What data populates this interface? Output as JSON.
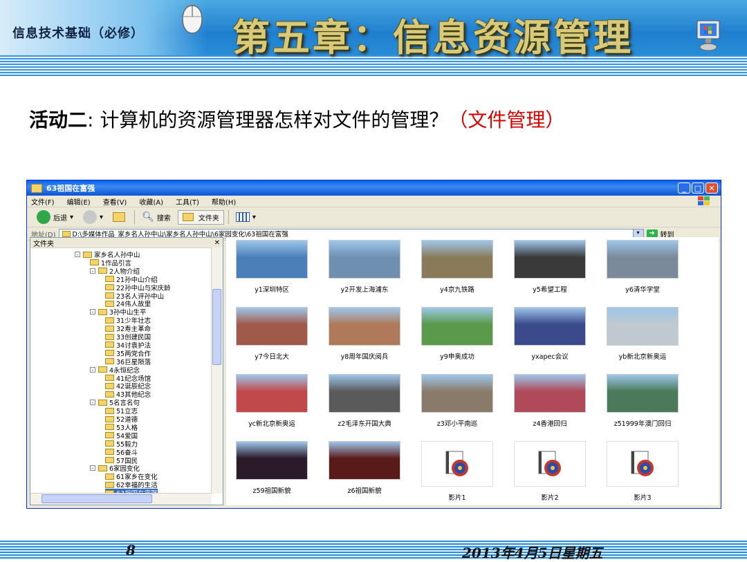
{
  "header": {
    "course": "信息技术基础（必修）",
    "chapter_title": "第五章：信息资源管理"
  },
  "question": {
    "label": "活动二",
    "sep": ":",
    "text": " 计算机的资源管理器怎样对文件的管理？",
    "highlight": "（文件管理）",
    "highlight_color": "#d40000"
  },
  "window": {
    "title": "63祖国在富强",
    "menu": [
      "文件(F)",
      "编辑(E)",
      "查看(V)",
      "收藏(A)",
      "工具(T)",
      "帮助(H)"
    ],
    "toolbar": {
      "back": "后退",
      "search": "搜索",
      "folders": "文件夹"
    },
    "address_label": "地址(D)",
    "address_value": "D:\\多媒体作品_家乡名人孙中山\\家乡名人孙中山\\6家园变化\\63祖国在富强",
    "go": "转到",
    "left_pane_title": "文件夹",
    "tree": [
      {
        "label": "家乡名人孙中山",
        "level": 0,
        "toggle": "⊟"
      },
      {
        "label": "1作品引言",
        "level": 1,
        "toggle": ""
      },
      {
        "label": "2人物介绍",
        "level": 1,
        "toggle": "⊟"
      },
      {
        "label": "21孙中山介绍",
        "level": 2,
        "toggle": ""
      },
      {
        "label": "22孙中山与宋庆龄",
        "level": 2,
        "toggle": ""
      },
      {
        "label": "23名人评孙中山",
        "level": 2,
        "toggle": ""
      },
      {
        "label": "24伟人故里",
        "level": 2,
        "toggle": ""
      },
      {
        "label": "3孙中山生平",
        "level": 1,
        "toggle": "⊟"
      },
      {
        "label": "31少年壮志",
        "level": 2,
        "toggle": ""
      },
      {
        "label": "32寿主革命",
        "level": 2,
        "toggle": ""
      },
      {
        "label": "33创建民国",
        "level": 2,
        "toggle": ""
      },
      {
        "label": "34讨袁护法",
        "level": 2,
        "toggle": ""
      },
      {
        "label": "35两党合作",
        "level": 2,
        "toggle": ""
      },
      {
        "label": "36巨星陨落",
        "level": 2,
        "toggle": ""
      },
      {
        "label": "4永恒纪念",
        "level": 1,
        "toggle": "⊟"
      },
      {
        "label": "41纪念场馆",
        "level": 2,
        "toggle": ""
      },
      {
        "label": "42诞辰纪念",
        "level": 2,
        "toggle": ""
      },
      {
        "label": "43其他纪念",
        "level": 2,
        "toggle": ""
      },
      {
        "label": "5名言名句",
        "level": 1,
        "toggle": "⊟"
      },
      {
        "label": "51立志",
        "level": 2,
        "toggle": ""
      },
      {
        "label": "52道德",
        "level": 2,
        "toggle": ""
      },
      {
        "label": "53人格",
        "level": 2,
        "toggle": ""
      },
      {
        "label": "54爱国",
        "level": 2,
        "toggle": ""
      },
      {
        "label": "55毅力",
        "level": 2,
        "toggle": ""
      },
      {
        "label": "56奋斗",
        "level": 2,
        "toggle": ""
      },
      {
        "label": "57国民",
        "level": 2,
        "toggle": ""
      },
      {
        "label": "6家园变化",
        "level": 1,
        "toggle": "⊟"
      },
      {
        "label": "61家乡在变化",
        "level": 2,
        "toggle": ""
      },
      {
        "label": "62幸福的生活",
        "level": 2,
        "toggle": ""
      },
      {
        "label": "63祖国在富强",
        "level": 2,
        "toggle": "",
        "selected": true
      }
    ],
    "files": [
      {
        "name": "y1深圳特区",
        "kind": "image",
        "color": "#4a7fb8"
      },
      {
        "name": "y2开发上海浦东",
        "kind": "image",
        "color": "#6f8fb0"
      },
      {
        "name": "y4京九铁路",
        "kind": "image",
        "color": "#8a7a5a"
      },
      {
        "name": "y5希望工程",
        "kind": "image",
        "color": "#3a3a3a"
      },
      {
        "name": "y6清华学堂",
        "kind": "image",
        "color": "#7a8a9a"
      },
      {
        "name": "y7今日北大",
        "kind": "image",
        "color": "#a05a4a"
      },
      {
        "name": "y8周年国庆阅兵",
        "kind": "image",
        "color": "#b07a5a"
      },
      {
        "name": "y9申奥成功",
        "kind": "image",
        "color": "#5a9a4a"
      },
      {
        "name": "yxapec会议",
        "kind": "image",
        "color": "#3a4a8a"
      },
      {
        "name": "yb新北京新奥运",
        "kind": "image",
        "color": "#c0c8d0"
      },
      {
        "name": "yc新北京新奥运",
        "kind": "image",
        "color": "#c04a4a"
      },
      {
        "name": "z2毛泽东开国大典",
        "kind": "image",
        "color": "#5a5a5a"
      },
      {
        "name": "z3邓小平南巡",
        "kind": "image",
        "color": "#8a7a6a"
      },
      {
        "name": "z4香港回归",
        "kind": "image",
        "color": "#b04a5a"
      },
      {
        "name": "z51999年澳门回归",
        "kind": "image",
        "color": "#4a7a5a"
      },
      {
        "name": "z59祖国新貌",
        "kind": "image",
        "color": "#2a1a2a"
      },
      {
        "name": "z6祖国新貌",
        "kind": "image",
        "color": "#5a1a1a"
      },
      {
        "name": "影片1",
        "kind": "video",
        "color": "#ffffff"
      },
      {
        "name": "影片2",
        "kind": "video",
        "color": "#ffffff"
      },
      {
        "name": "影片3",
        "kind": "video",
        "color": "#ffffff"
      }
    ]
  },
  "footer": {
    "page": "8",
    "date": "2013年4月5日星期五"
  },
  "icons": [
    "mouse-icon",
    "computer-icon",
    "folder-icon",
    "back-arrow-icon",
    "forward-arrow-icon",
    "up-folder-icon",
    "search-icon",
    "views-icon",
    "go-arrow-icon",
    "video-file-icon",
    "windows-logo-icon"
  ]
}
